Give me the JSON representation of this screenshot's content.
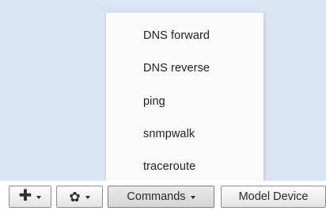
{
  "menu": {
    "items": [
      {
        "label": "DNS forward"
      },
      {
        "label": "DNS reverse"
      },
      {
        "label": "ping"
      },
      {
        "label": "snmpwalk"
      },
      {
        "label": "traceroute"
      }
    ]
  },
  "toolbar": {
    "add_icon": "plus-icon",
    "settings_icon": "gear-icon",
    "commands_label": "Commands",
    "model_device_label": "Model Device"
  },
  "colors": {
    "panel_background": "#d9e5f2",
    "menu_background": "#fafafa",
    "button_border": "#8c8c8c"
  }
}
